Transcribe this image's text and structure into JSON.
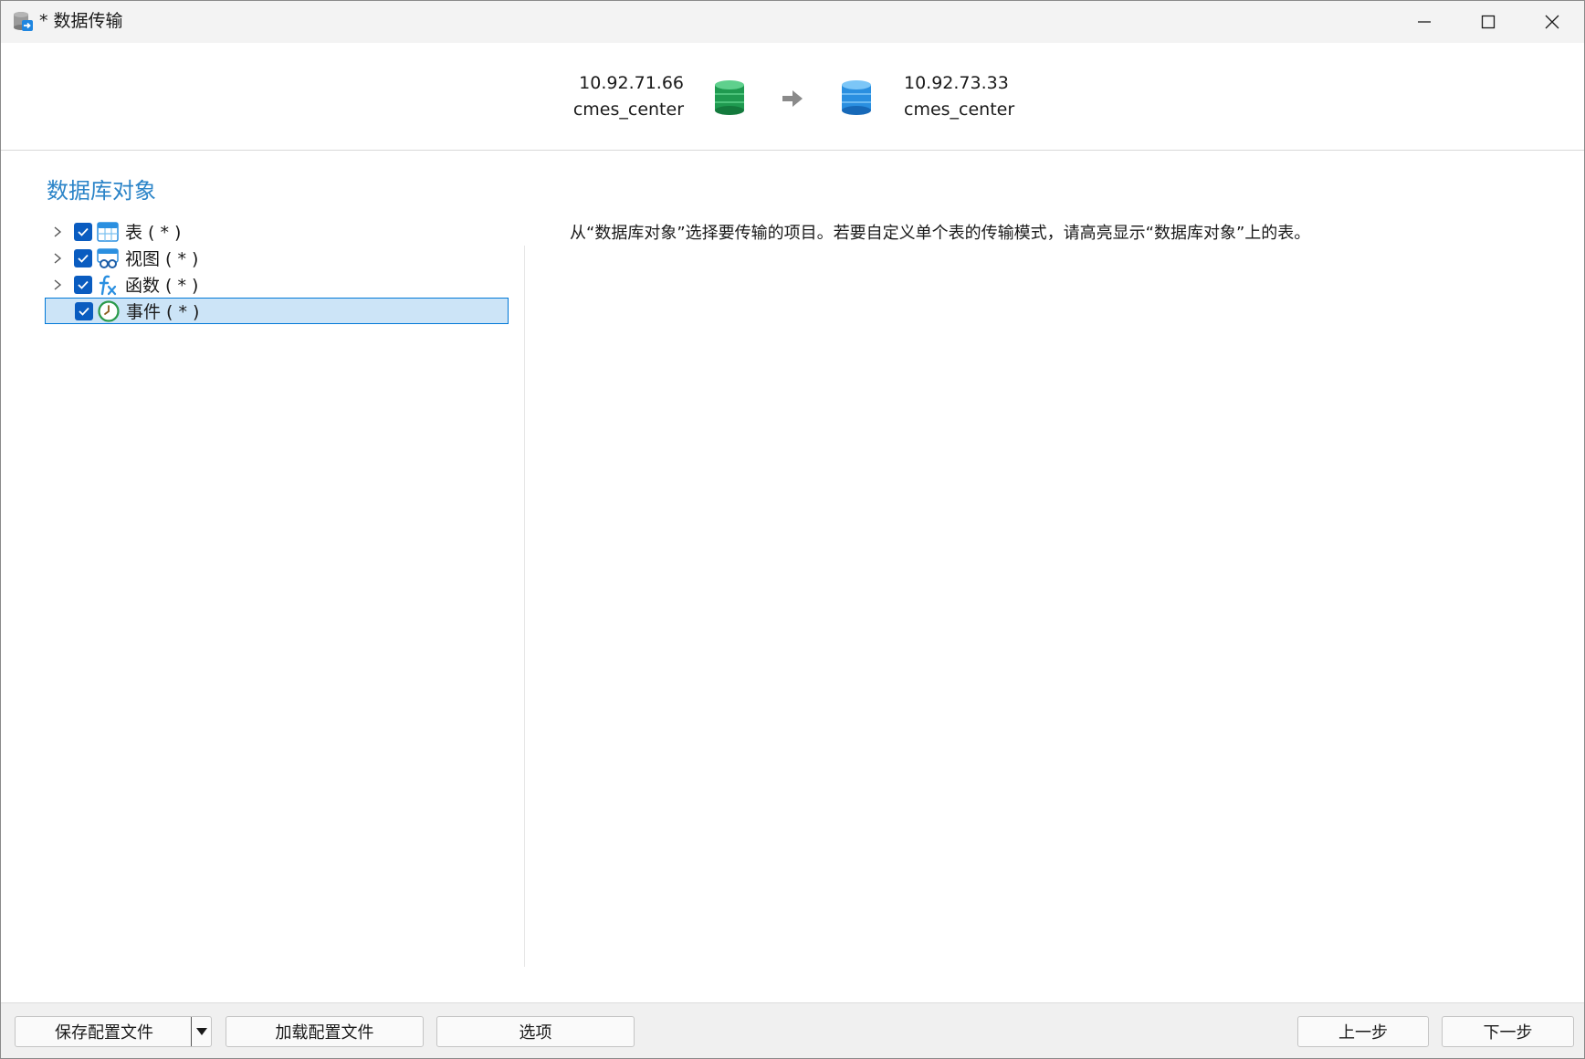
{
  "window": {
    "title": "* 数据传输",
    "icons": {
      "app": "data-transfer-icon",
      "minimize": "minimize-icon",
      "maximize": "maximize-icon",
      "close": "close-icon"
    }
  },
  "connection": {
    "source": {
      "host": "10.92.71.66",
      "database": "cmes_center",
      "icon": "database-green-icon",
      "color": "#2aa65a"
    },
    "arrow_icon": "arrow-right-icon",
    "target": {
      "host": "10.92.73.33",
      "database": "cmes_center",
      "icon": "database-blue-icon",
      "color": "#2a8fe0"
    }
  },
  "objects": {
    "title": "数据库对象",
    "items": [
      {
        "label": "表 ( * )",
        "checked": true,
        "expandable": true,
        "icon": "table-icon"
      },
      {
        "label": "视图 ( * )",
        "checked": true,
        "expandable": true,
        "icon": "view-icon"
      },
      {
        "label": "函数 ( * )",
        "checked": true,
        "expandable": true,
        "icon": "function-icon"
      },
      {
        "label": "事件 ( * )",
        "checked": true,
        "expandable": false,
        "icon": "event-clock-icon",
        "selected": true
      }
    ]
  },
  "info": {
    "text": "从“数据库对象”选择要传输的项目。若要自定义单个表的传输模式，请高亮显示“数据库对象”上的表。"
  },
  "footer": {
    "save_profile": "保存配置文件",
    "load_profile": "加载配置文件",
    "options": "选项",
    "back": "上一步",
    "next": "下一步"
  },
  "colors": {
    "accent": "#0078d7",
    "section_title": "#2b84c8",
    "selection_bg": "#cce4f7",
    "checkbox": "#0a5cc0"
  }
}
